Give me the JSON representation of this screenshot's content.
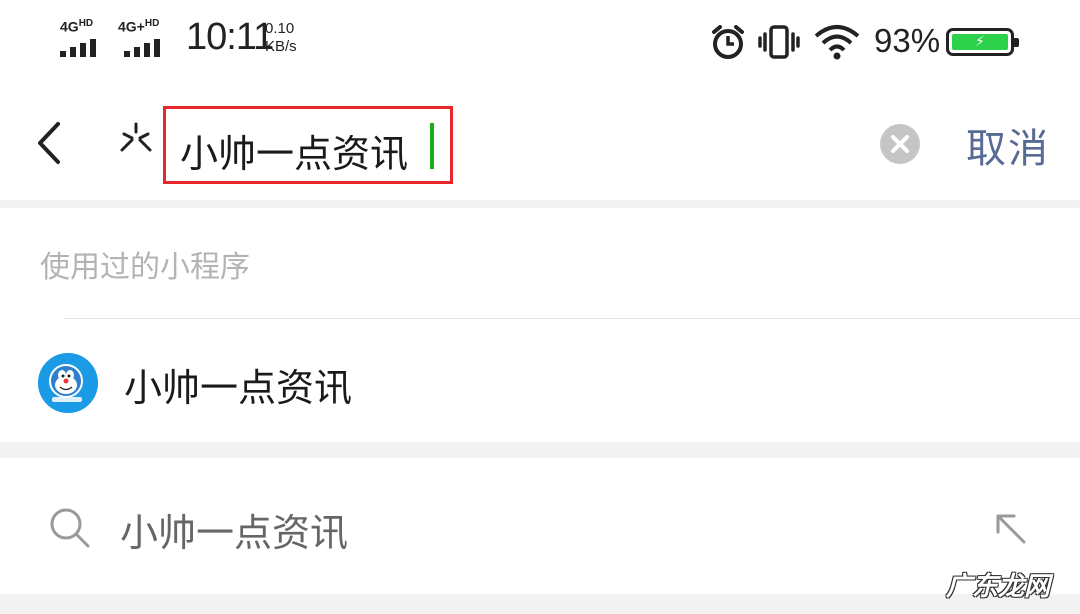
{
  "status_bar": {
    "sim1_label": "4G",
    "sim1_sup": "HD",
    "sim2_label": "4G+",
    "sim2_sup": "HD",
    "time": "10:11",
    "net_speed_value": "0.10",
    "net_speed_unit": "KB/s",
    "battery_percent": "93%",
    "icons": [
      "alarm-icon",
      "vibrate-icon",
      "wifi-icon",
      "battery-icon"
    ],
    "battery_color": "#2ed24a"
  },
  "search": {
    "query": "小帅一点资讯",
    "cancel_label": "取消",
    "highlight_color": "#e8262b",
    "caret_color": "#1aad19",
    "cancel_color": "#576b95"
  },
  "recent_mini_programs": {
    "title": "使用过的小程序",
    "items": [
      {
        "name": "小帅一点资讯",
        "icon": "doraemon-avatar"
      }
    ]
  },
  "suggestion": {
    "text": "小帅一点资讯"
  },
  "watermark": "广东龙网"
}
